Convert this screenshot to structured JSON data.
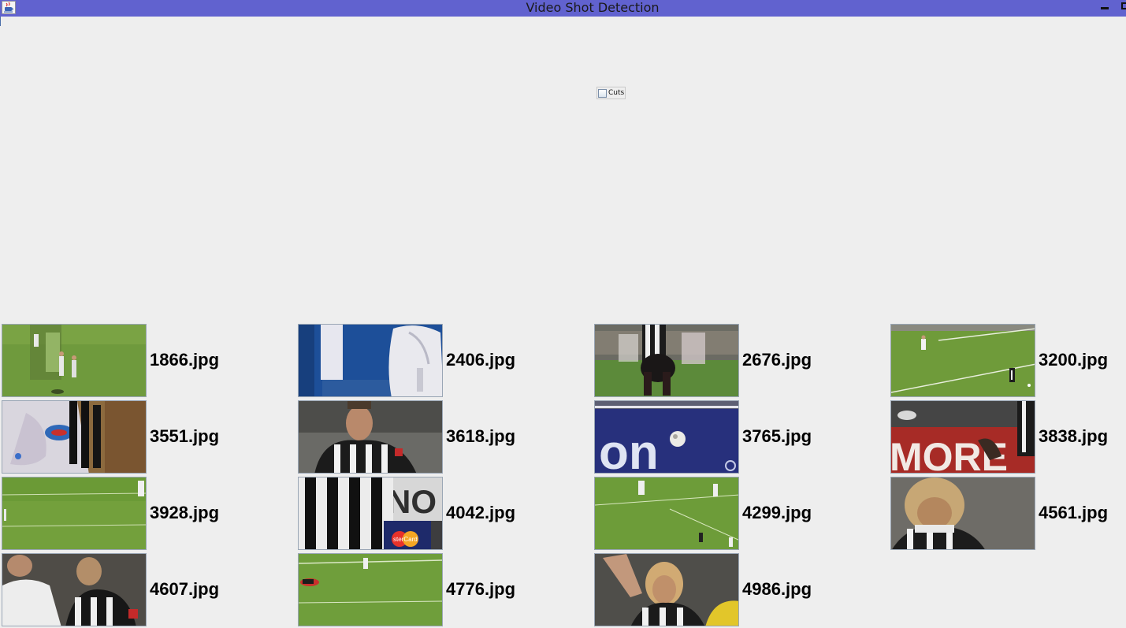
{
  "window": {
    "title": "Video Shot Detection",
    "titlebar_color": "#6162cf",
    "background": "#eeeeee",
    "icon": "java-cup-icon",
    "controls": [
      "minimize-icon",
      "maximize-icon"
    ]
  },
  "controls": {
    "cuts_label": "Cuts",
    "cuts_checked": false
  },
  "thumbnails": [
    {
      "label": "1866.jpg",
      "scene": "field-players"
    },
    {
      "label": "2406.jpg",
      "scene": "blue-wall-jersey"
    },
    {
      "label": "2676.jpg",
      "scene": "crowd-players"
    },
    {
      "label": "3200.jpg",
      "scene": "field-wide"
    },
    {
      "label": "3551.jpg",
      "scene": "closeup-stripes"
    },
    {
      "label": "3618.jpg",
      "scene": "player-closeup"
    },
    {
      "label": "3765.jpg",
      "scene": "banner-ball"
    },
    {
      "label": "3838.jpg",
      "scene": "more-banner"
    },
    {
      "label": "3928.jpg",
      "scene": "empty-field"
    },
    {
      "label": "4042.jpg",
      "scene": "stripes-mastercard"
    },
    {
      "label": "4299.jpg",
      "scene": "field-lines"
    },
    {
      "label": "4561.jpg",
      "scene": "blond-player"
    },
    {
      "label": "4607.jpg",
      "scene": "two-players"
    },
    {
      "label": "4776.jpg",
      "scene": "player-down"
    },
    {
      "label": "4986.jpg",
      "scene": "celebration"
    }
  ]
}
